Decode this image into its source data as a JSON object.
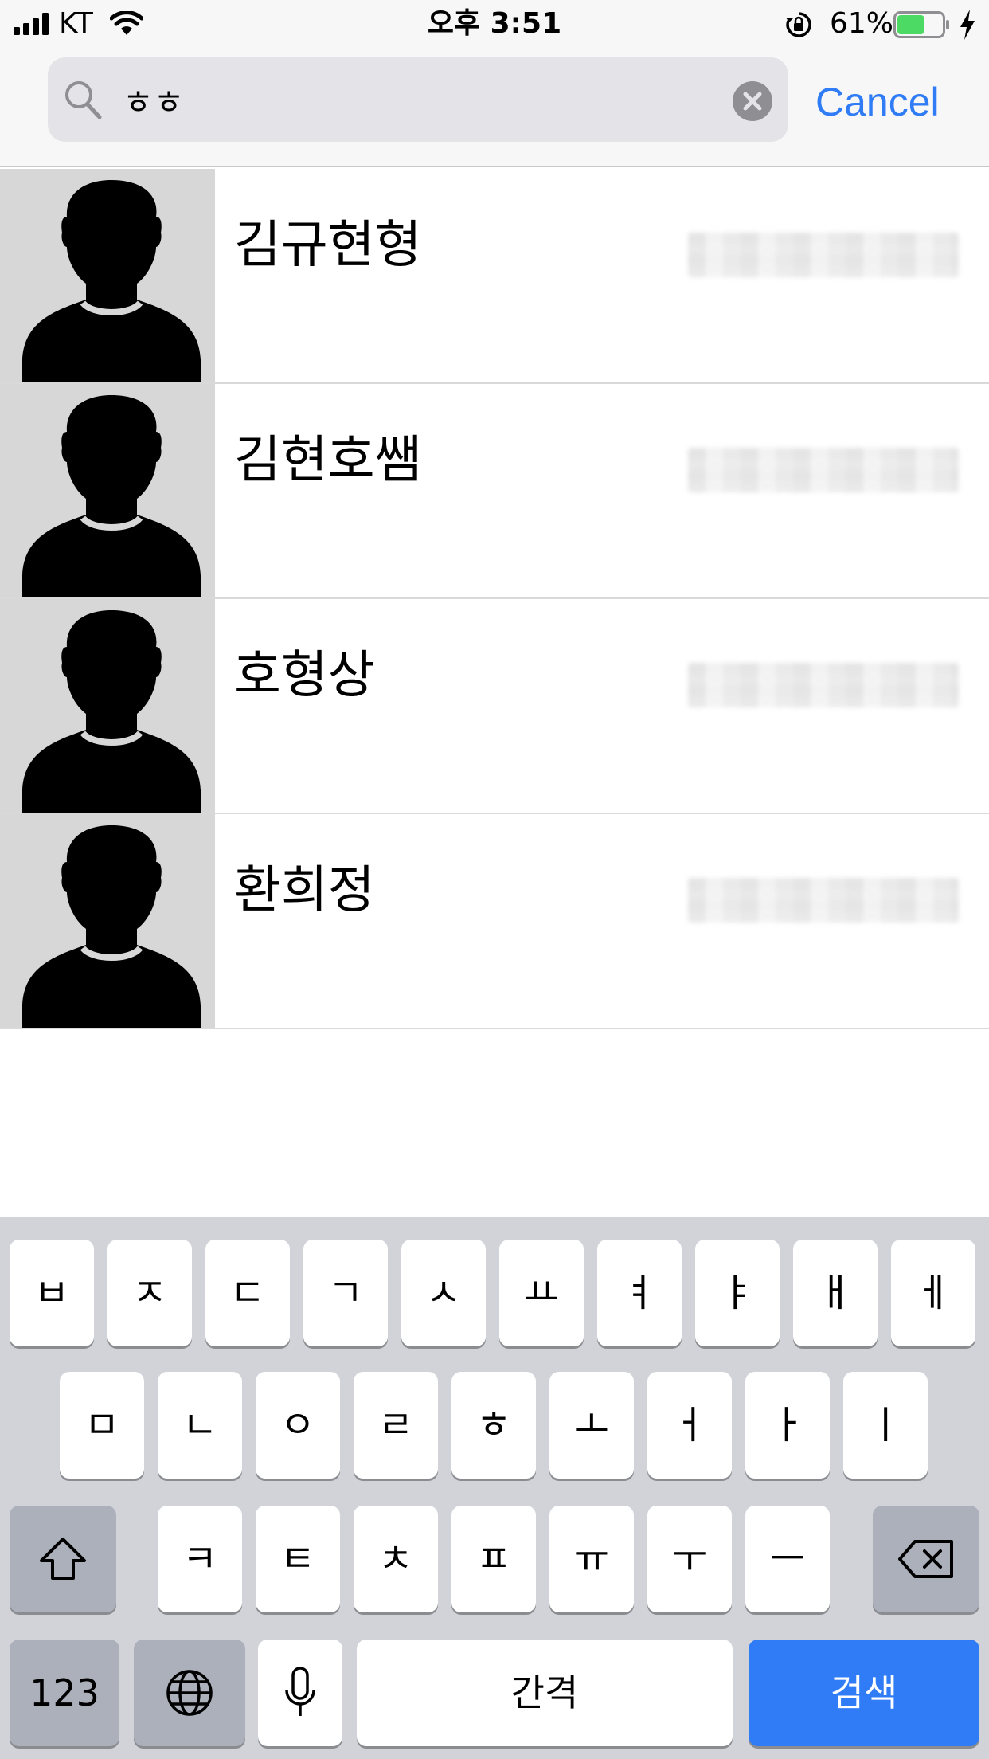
{
  "status_bar": {
    "carrier": "KT",
    "time": "오후 3:51",
    "battery_percent": "61%",
    "battery_level": 0.61
  },
  "search": {
    "query": "ㅎㅎ",
    "cancel_label": "Cancel"
  },
  "results": [
    {
      "name": "김규현형"
    },
    {
      "name": "김현호쌤"
    },
    {
      "name": "호형상"
    },
    {
      "name": "환희정"
    }
  ],
  "keyboard": {
    "row1": [
      "ㅂ",
      "ㅈ",
      "ㄷ",
      "ㄱ",
      "ㅅ",
      "ㅛ",
      "ㅕ",
      "ㅑ",
      "ㅐ",
      "ㅔ"
    ],
    "row2": [
      "ㅁ",
      "ㄴ",
      "ㅇ",
      "ㄹ",
      "ㅎ",
      "ㅗ",
      "ㅓ",
      "ㅏ",
      "ㅣ"
    ],
    "row3": [
      "ㅋ",
      "ㅌ",
      "ㅊ",
      "ㅍ",
      "ㅠ",
      "ㅜ",
      "ㅡ"
    ],
    "numbers_label": "123",
    "space_label": "간격",
    "search_label": "검색"
  },
  "colors": {
    "accent": "#2f7cf6",
    "keyboard_bg": "#d1d3d9",
    "avatar_bg": "#d7d7d7"
  }
}
